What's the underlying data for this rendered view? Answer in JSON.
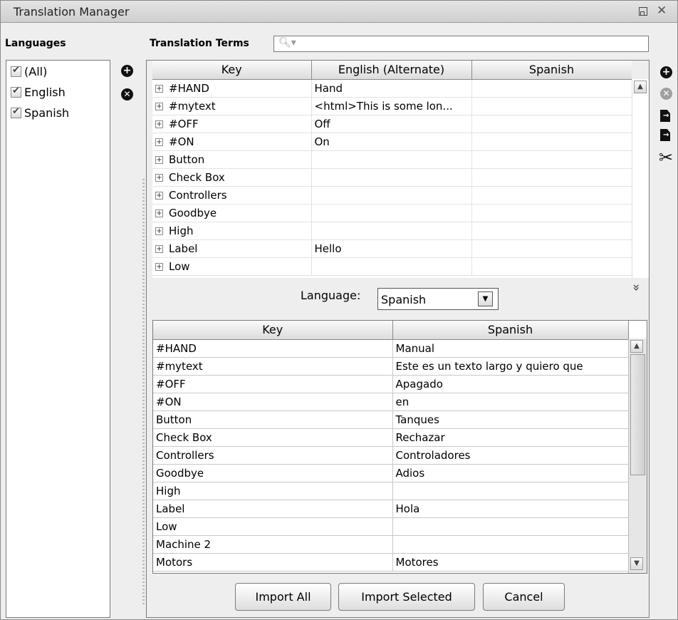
{
  "window": {
    "title": "Translation Manager"
  },
  "languages": {
    "label": "Languages",
    "items": [
      {
        "label": "(All)"
      },
      {
        "label": "English"
      },
      {
        "label": "Spanish"
      }
    ]
  },
  "terms": {
    "label": "Translation Terms",
    "search_placeholder": ""
  },
  "top_table": {
    "headers": [
      "Key",
      "English (Alternate)",
      "Spanish"
    ],
    "rows": [
      [
        "#HAND",
        "Hand",
        ""
      ],
      [
        "#mytext",
        "<html>This is some lon...",
        ""
      ],
      [
        "#OFF",
        "Off",
        ""
      ],
      [
        "#ON",
        "On",
        ""
      ],
      [
        "Button",
        "",
        ""
      ],
      [
        "Check Box",
        "",
        ""
      ],
      [
        "Controllers",
        "",
        ""
      ],
      [
        "Goodbye",
        "",
        ""
      ],
      [
        "High",
        "",
        ""
      ],
      [
        "Label",
        "Hello",
        ""
      ],
      [
        "Low",
        "",
        ""
      ]
    ]
  },
  "language_picker": {
    "label": "Language:",
    "value": "Spanish"
  },
  "bottom_table": {
    "headers": [
      "Key",
      "Spanish"
    ],
    "rows": [
      [
        "#HAND",
        "Manual"
      ],
      [
        "#mytext",
        "Este es un texto largo y quiero que"
      ],
      [
        "#OFF",
        "Apagado"
      ],
      [
        "#ON",
        "en"
      ],
      [
        "Button",
        "Tanques"
      ],
      [
        "Check Box",
        "Rechazar"
      ],
      [
        "Controllers",
        "Controladores"
      ],
      [
        "Goodbye",
        "Adios"
      ],
      [
        "High",
        ""
      ],
      [
        "Label",
        "Hola"
      ],
      [
        "Low",
        ""
      ],
      [
        "Machine 2",
        ""
      ],
      [
        "Motors",
        "Motores"
      ]
    ]
  },
  "buttons": {
    "import_all": "Import All",
    "import_selected": "Import Selected",
    "cancel": "Cancel"
  }
}
